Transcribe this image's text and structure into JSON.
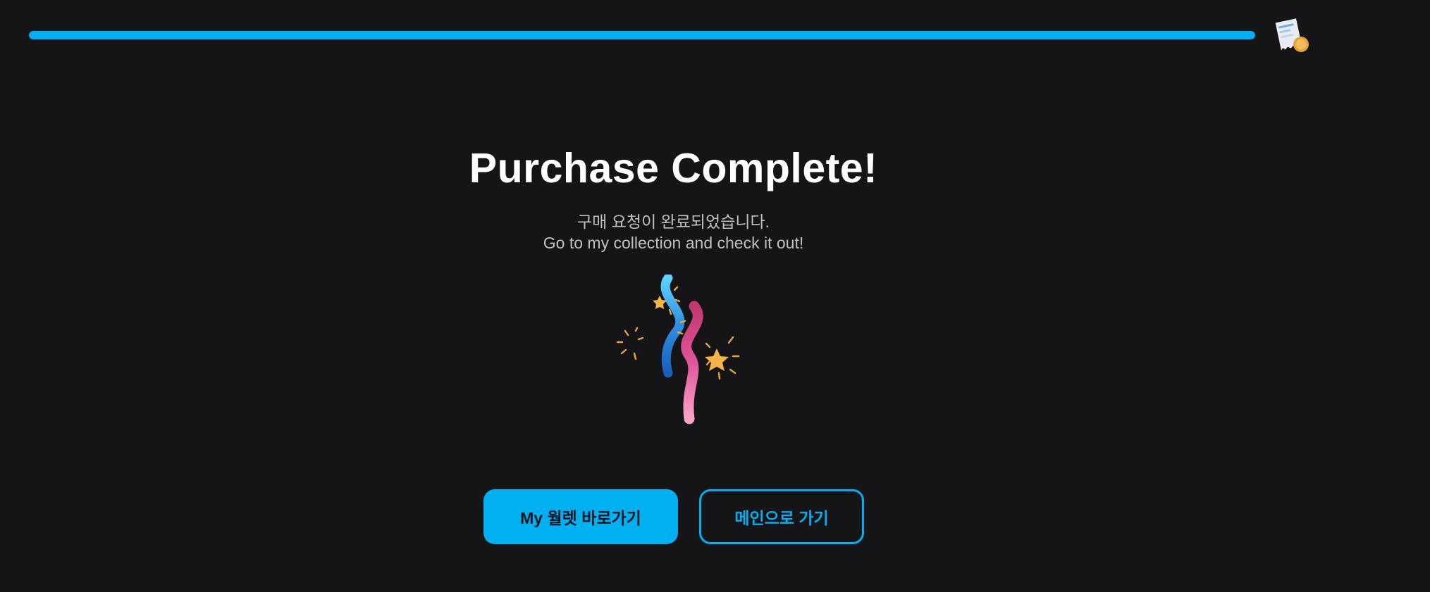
{
  "progress": {
    "value": 1.0,
    "color": "#00b0f0"
  },
  "header": {
    "icon": "receipt-coin-icon"
  },
  "main": {
    "title": "Purchase Complete!",
    "subtitle_ko": "구매 요청이 완료되었습니다.",
    "subtitle_en": "Go to my collection and check it out!",
    "illustration": "party-confetti-icon"
  },
  "actions": {
    "primary_label": "My 월렛 바로가기",
    "secondary_label": "메인으로 가기"
  },
  "colors": {
    "background": "#151517",
    "accent": "#00b0f0",
    "subtitle": "#bfc0c4"
  }
}
